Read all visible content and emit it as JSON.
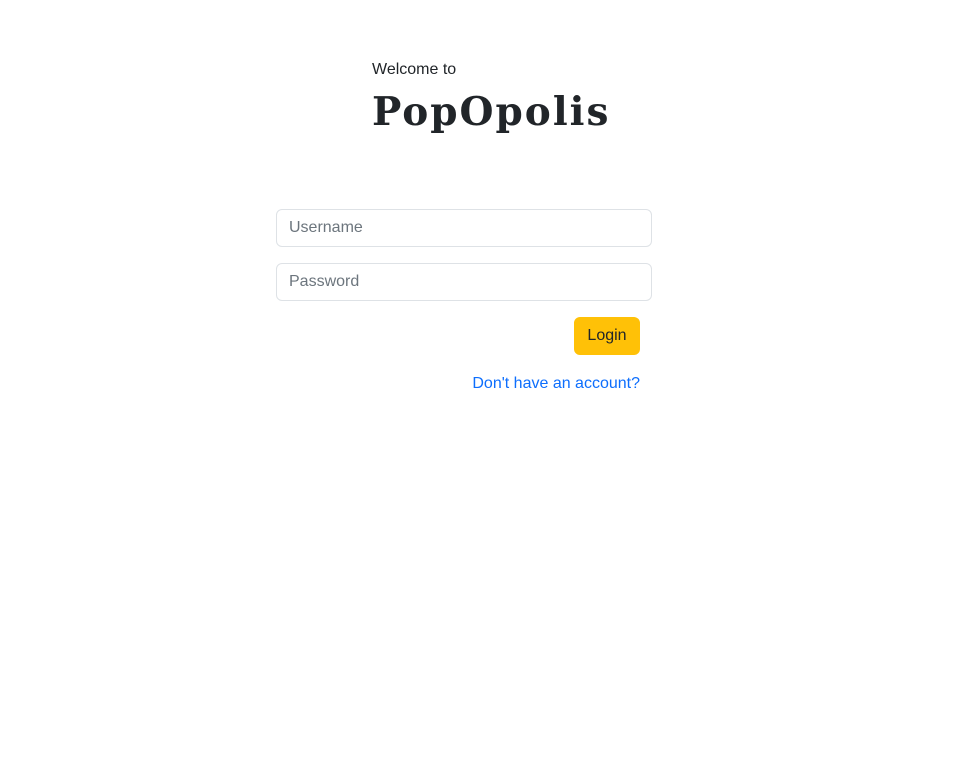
{
  "header": {
    "welcome_text": "Welcome to",
    "brand_name": "PopOpolis"
  },
  "form": {
    "username_placeholder": "Username",
    "username_value": "",
    "password_placeholder": "Password",
    "password_value": "",
    "login_label": "Login",
    "signup_link_label": "Don't have an account?"
  },
  "colors": {
    "accent": "#ffc107",
    "link": "#0d6efd",
    "text": "#212529",
    "border": "#dee2e6",
    "placeholder": "#6c757d"
  }
}
